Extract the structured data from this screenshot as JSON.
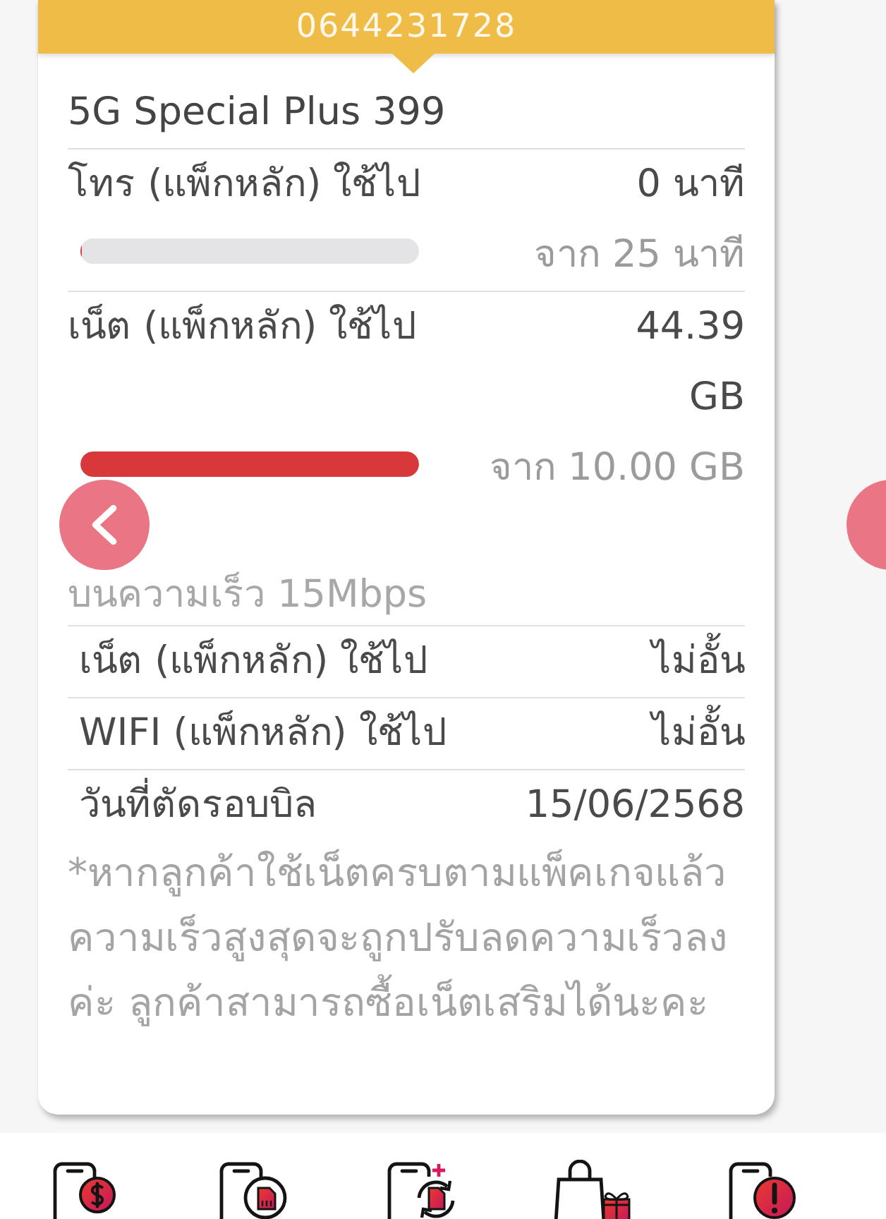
{
  "header": {
    "phone_number": "0644231728"
  },
  "package": {
    "name": "5G Special Plus 399",
    "usages": [
      {
        "label": "โทร (แพ็กหลัก) ใช้ไป",
        "used": "0 นาที",
        "level": 0,
        "total": "จาก 25 นาที"
      },
      {
        "label": "เน็ต (แพ็กหลัก) ใช้ไป",
        "used": "44.39 GB",
        "level": 1,
        "total": "จาก 10.00 GB",
        "note": "บนความเร็ว 15Mbps"
      }
    ],
    "unlimited": [
      {
        "label": "เน็ต (แพ็กหลัก) ใช้ไป",
        "value": "ไม่อั้น"
      },
      {
        "label": "WIFI (แพ็กหลัก) ใช้ไป",
        "value": "ไม่อั้น"
      }
    ],
    "billing": {
      "label": "วันที่ตัดรอบบิล",
      "value": "15/06/2568"
    },
    "footnote": "*หากลูกค้าใช้เน็ตครบตามแพ็คเกจแล้วความเร็วสูงสุดจะถูกปรับลดความเร็วลงค่ะ ลูกค้าสามารถซื้อเน็ตเสริมได้นะคะ"
  }
}
